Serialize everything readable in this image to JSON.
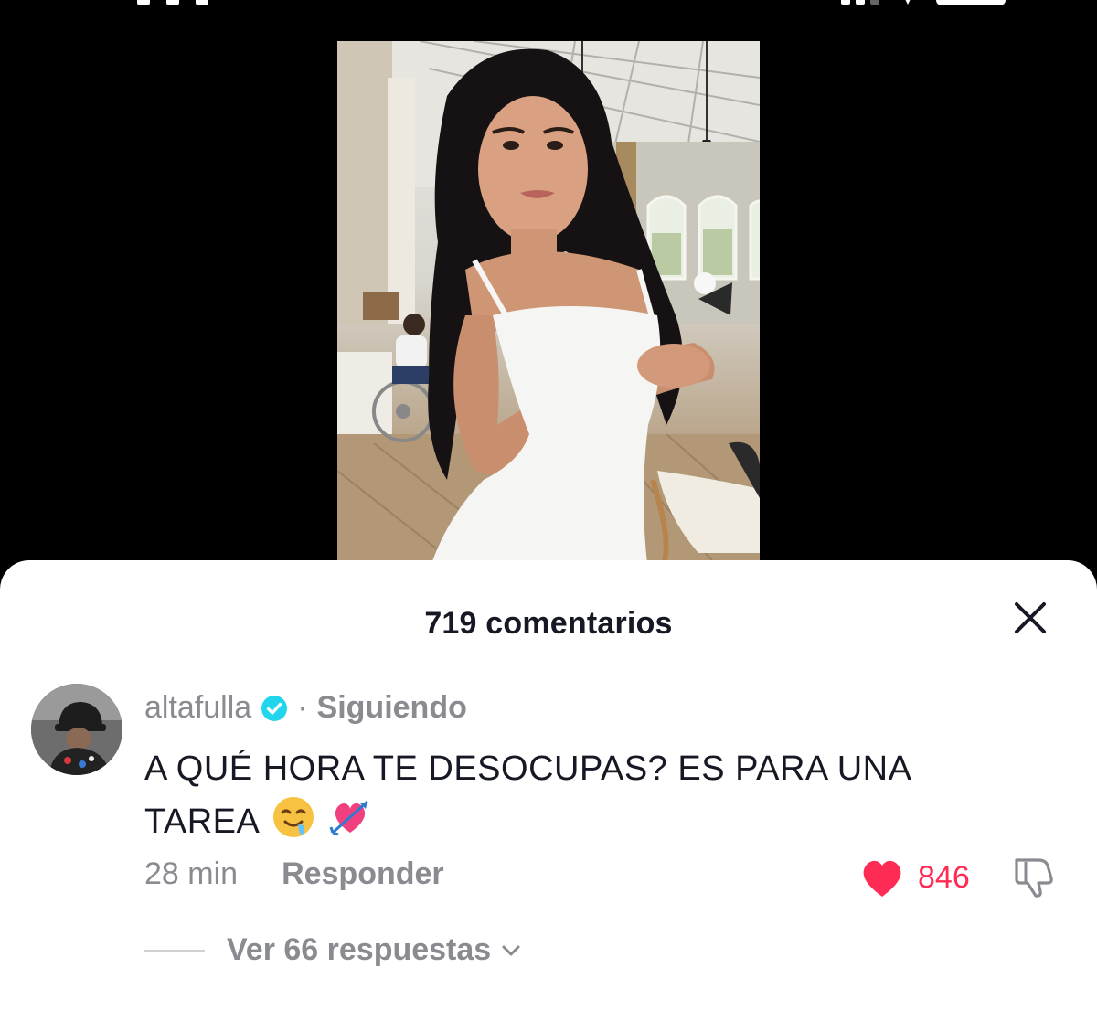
{
  "video": {
    "description_icon": "video-player"
  },
  "comments_sheet": {
    "title": "719 comentarios",
    "close_icon": "close-icon"
  },
  "comment": {
    "username": "altafulla",
    "verified_icon": "verified-badge-icon",
    "separator": "·",
    "follow_state": "Siguiendo",
    "text": "A QUÉ HORA TE DESOCUPAS? ES PARA UNA TAREA",
    "emojis": [
      "drooling-face-emoji",
      "heart-with-arrow-emoji"
    ],
    "time": "28 min",
    "reply_label": "Responder",
    "like_count": "846",
    "like_icon": "heart-filled-icon",
    "dislike_icon": "thumbs-down-icon",
    "replies_label": "Ver 66 respuestas"
  },
  "colors": {
    "like": "#fe2c55",
    "verified": "#20d5ec",
    "muted_text": "#8a8b91",
    "primary_text": "#161823"
  }
}
